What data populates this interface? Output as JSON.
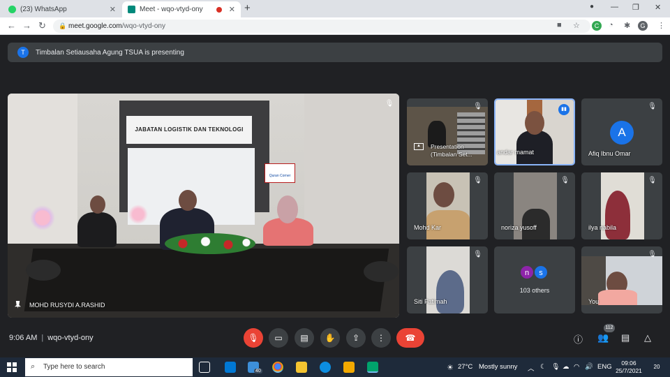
{
  "browser": {
    "tabs": [
      {
        "title": "(23) WhatsApp",
        "active": false,
        "favicon_color": "#25d366"
      },
      {
        "title": "Meet - wqo-vtyd-ony",
        "active": true,
        "favicon_color": "#00897b"
      }
    ],
    "new_tab_symbol": "+",
    "url_host": "meet.google.com",
    "url_path": "/wqo-vtyd-ony",
    "profile_initial": "G",
    "extension_initial": "C"
  },
  "banner": {
    "avatar_initial": "T",
    "text": "Timbalan Setiausaha Agung TSUA is presenting"
  },
  "main_video": {
    "sign_text": "JABATAN LOGISTIK DAN TEKNOLOGI",
    "sub_sign": "Quran Corner",
    "speaker_name": "MOHD RUSYDI A.RASHID"
  },
  "tiles": [
    {
      "name": "Presentation (Timbalan Set...",
      "line1": "Presentation",
      "line2": "(Timbalan Set..."
    },
    {
      "name": "Iskandar mamat",
      "caption": "andar mamat"
    },
    {
      "name": "Afiq Ibnu Omar",
      "caption": "Afiq Ibnu Omar",
      "avatar_initial": "A"
    },
    {
      "name": "Mohd Kar",
      "caption": "Mohd Kar"
    },
    {
      "name": "noriza yusoff",
      "caption": "noriza yusoff"
    },
    {
      "name": "ilya nabila",
      "caption": "ilya nabila"
    },
    {
      "name": "Siti Fatimah",
      "caption": "Siti Fatimah"
    },
    {
      "name": "103 others",
      "caption": "103 others",
      "avatar_initials": [
        "n",
        "s"
      ]
    },
    {
      "name": "You",
      "caption": "You"
    }
  ],
  "meet_bar": {
    "time": "9:06 AM",
    "separator": "|",
    "meeting_code": "wqo-vtyd-ony",
    "participant_count": "112"
  },
  "taskbar": {
    "search_placeholder": "Type here to search",
    "mail_badge": "40",
    "weather": "27°C",
    "weather_text": "Mostly sunny",
    "language": "ENG",
    "time": "09:06",
    "date": "25/7/2021",
    "notifications": "20"
  },
  "colors": {
    "meet_bg": "#202124",
    "tile_bg": "#3c4043",
    "accent_blue": "#1a73e8",
    "danger_red": "#ea4335",
    "active_border": "#8ab4f8"
  }
}
